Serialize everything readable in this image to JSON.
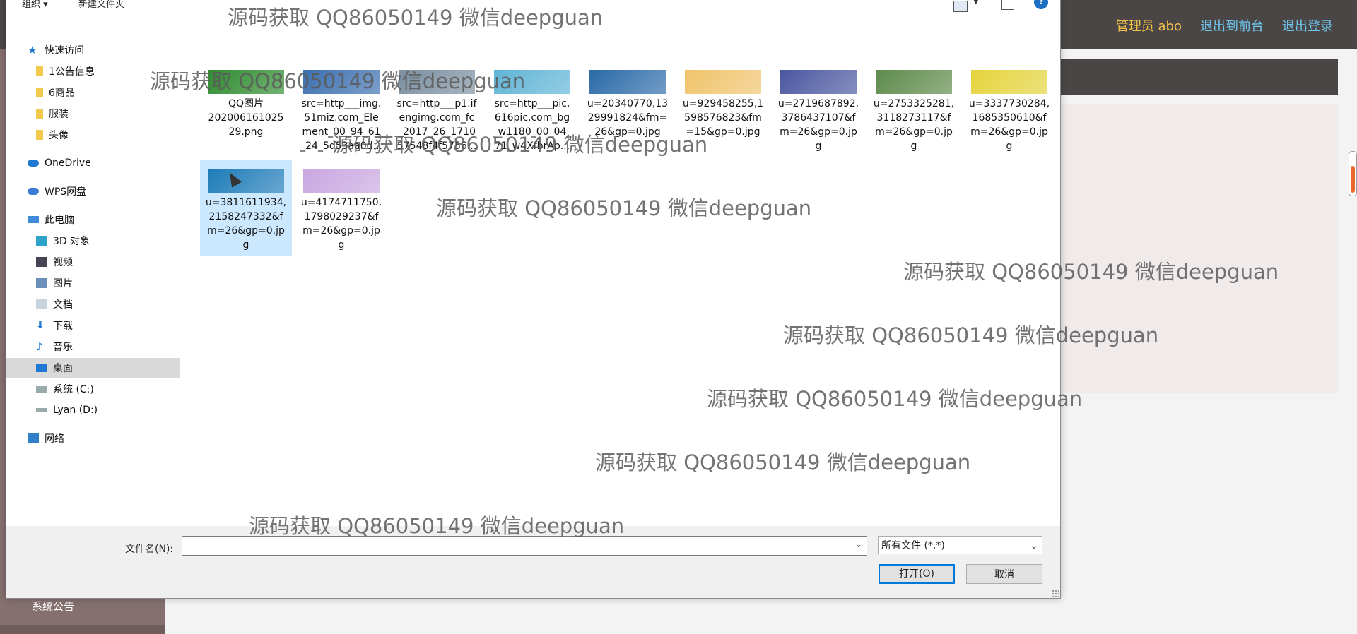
{
  "background": {
    "topbar": {
      "admin_label": "管理员 abo",
      "links": [
        "退出到前台",
        "退出登录"
      ]
    },
    "sidebar_item": "系统公告"
  },
  "dialog": {
    "toolbar": {
      "organize": "组织 ▾",
      "new_folder": "新建文件夹",
      "help": "?"
    },
    "nav": {
      "quick_access": "快速访问",
      "quick_items": [
        "1公告信息",
        "6商品",
        "服装",
        "头像"
      ],
      "onedrive": "OneDrive",
      "wps": "WPS网盘",
      "this_pc": "此电脑",
      "pc_items": [
        "3D 对象",
        "视频",
        "图片",
        "文档",
        "下载",
        "音乐",
        "桌面",
        "系统 (C:)",
        "Lyan (D:)"
      ],
      "network": "网络",
      "selected": "桌面"
    },
    "files": [
      {
        "name": "QQ图片20200616102529.png",
        "name_lines": [
          "QQ图片",
          "202006161025",
          "29.png"
        ],
        "thumb_color": "#2e8b2e"
      },
      {
        "name_lines": [
          "src=http___img.",
          "51miz.com_Ele",
          "ment_00_94_61",
          "_24_5d53aa0d..."
        ],
        "thumb_color": "#3b6fb0"
      },
      {
        "name_lines": [
          "src=http___p1.if",
          "engimg.com_fc",
          "_2017_26_1710",
          "57548f4f5756..."
        ],
        "thumb_color": "#7b8fa0"
      },
      {
        "name_lines": [
          "src=http___pic.",
          "616pic.com_bg",
          "_w1180_00_04_",
          "71_w4XfbrAp..."
        ],
        "thumb_color": "#5fb4d6"
      },
      {
        "name_lines": [
          "u=20340770,13",
          "29991824&fm=",
          "26&gp=0.jpg"
        ],
        "thumb_color": "#2a6aa8"
      },
      {
        "name_lines": [
          "u=929458255,1",
          "598576823&fm",
          "=15&gp=0.jpg"
        ],
        "thumb_color": "#f0c36b"
      },
      {
        "name_lines": [
          "u=2719687892,",
          "3786437107&f",
          "m=26&gp=0.jp",
          "g"
        ],
        "thumb_color": "#4a57a0"
      },
      {
        "name_lines": [
          "u=2753325281,",
          "3118273117&f",
          "m=26&gp=0.jp",
          "g"
        ],
        "thumb_color": "#5d8a4a"
      },
      {
        "name_lines": [
          "u=3337730284,",
          "1685350610&f",
          "m=26&gp=0.jp",
          "g"
        ],
        "thumb_color": "#e4d33b"
      },
      {
        "name_lines": [
          "u=3811611934,",
          "2158247332&f",
          "m=26&gp=0.jp",
          "g"
        ],
        "thumb_color": "#1d7bb8",
        "selected": true
      },
      {
        "name_lines": [
          "u=4174711750,",
          "1798029237&f",
          "m=26&gp=0.jp",
          "g"
        ],
        "thumb_color": "#c9a6e0"
      }
    ],
    "bottom": {
      "filename_label": "文件名(N):",
      "filename_value": "",
      "filetype": "所有文件 (*.*)",
      "open": "打开(O)",
      "cancel": "取消"
    }
  },
  "watermark": "源码获取 QQ86050149 微信deepguan"
}
